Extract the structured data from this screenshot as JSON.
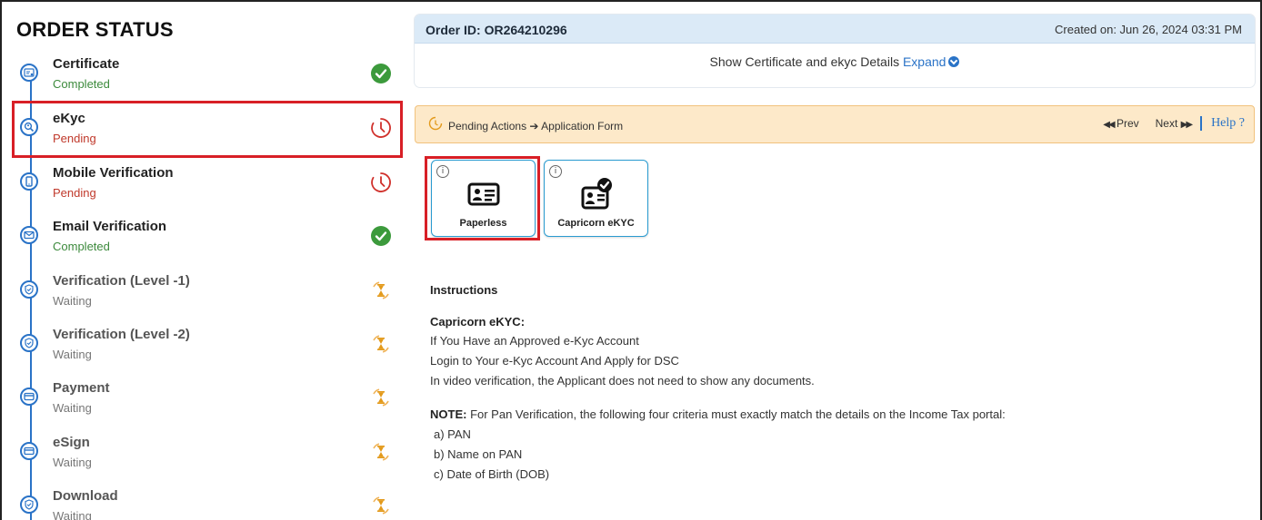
{
  "sidebar": {
    "title": "ORDER STATUS",
    "steps": [
      {
        "title": "Certificate",
        "status": "Completed",
        "state": "completed",
        "icon": "certificate-icon"
      },
      {
        "title": "eKyc",
        "status": "Pending",
        "state": "pending",
        "icon": "ekyc-search-icon"
      },
      {
        "title": "Mobile Verification",
        "status": "Pending",
        "state": "pending",
        "icon": "mobile-icon"
      },
      {
        "title": "Email Verification",
        "status": "Completed",
        "state": "completed",
        "icon": "email-icon"
      },
      {
        "title": "Verification (Level -1)",
        "status": "Waiting",
        "state": "waiting",
        "icon": "shield-icon"
      },
      {
        "title": "Verification (Level -2)",
        "status": "Waiting",
        "state": "waiting",
        "icon": "shield-icon"
      },
      {
        "title": "Payment",
        "status": "Waiting",
        "state": "waiting",
        "icon": "card-icon"
      },
      {
        "title": "eSign",
        "status": "Waiting",
        "state": "waiting",
        "icon": "card-icon"
      },
      {
        "title": "Download",
        "status": "Waiting",
        "state": "waiting",
        "icon": "shield-icon"
      }
    ]
  },
  "order": {
    "id_label": "Order ID: OR264210296",
    "created_on": "Created on: Jun 26, 2024 03:31 PM",
    "show_details": "Show Certificate and ekyc Details",
    "expand_label": "Expand"
  },
  "pending_bar": {
    "breadcrumb_start": "Pending Actions",
    "breadcrumb_end": "Application Form",
    "prev_label": "Prev",
    "next_label": "Next",
    "help_label": "Help ?"
  },
  "options": [
    {
      "label": "Paperless",
      "info": "i"
    },
    {
      "label": "Capricorn eKYC",
      "info": "i"
    }
  ],
  "instructions": {
    "heading": "Instructions",
    "subheading": "Capricorn eKYC:",
    "lines": [
      "If You Have an Approved e-Kyc Account",
      "Login to Your e-Kyc Account And Apply for DSC",
      "In video verification, the Applicant does not need to show any documents."
    ],
    "note_label": "NOTE:",
    "note_text": " For Pan Verification, the following four criteria must exactly match the details on the Income Tax portal:",
    "criteria": [
      "a) PAN",
      "b) Name on PAN",
      "c) Date of Birth (DOB)"
    ]
  },
  "colors": {
    "accent_blue": "#2a73c7",
    "completed_green": "#3c9a3c",
    "pending_red": "#d0302b",
    "waiting_orange": "#e39a1b",
    "highlight_red": "#d81f26",
    "pending_bar_bg": "#fde9c9"
  }
}
